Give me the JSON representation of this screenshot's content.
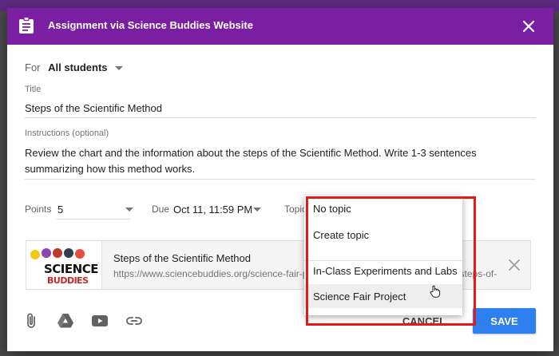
{
  "dialog": {
    "title": "Assignment via Science Buddies Website"
  },
  "assign": {
    "for_label": "For",
    "for_value": "All students"
  },
  "title_field": {
    "label": "Title",
    "value": "Steps of the Scientific Method"
  },
  "instructions_field": {
    "label": "Instructions (optional)",
    "value": "Review the chart and the information about the steps of the Scientific Method. Write 1-3 sentences summarizing how this method works."
  },
  "points": {
    "label": "Points",
    "value": "5"
  },
  "due": {
    "label": "Due",
    "value": "Oct 11, 11:59 PM"
  },
  "topic": {
    "label": "Topic",
    "menu_items": [
      "No topic",
      "Create topic",
      "In-Class Experiments and Labs",
      "Science Fair Project"
    ],
    "hovered_item": "Science Fair Project"
  },
  "attachment": {
    "title": "Steps of the Scientific Method",
    "url": "https://www.sciencebuddies.org/science-fair-projects/engineering-design-process/steps-of-the-scientific-method",
    "thumb_text": [
      "SCIENCE",
      "BUDDIES"
    ]
  },
  "toolbar": {
    "icons": [
      "attach-file-icon",
      "google-drive-icon",
      "youtube-icon",
      "link-icon"
    ]
  },
  "actions": {
    "cancel_label": "CANCEL",
    "save_label": "SAVE"
  },
  "colors": {
    "header": "#7b1fa2",
    "save": "#2e7ff0",
    "highlight": "#e21a1a"
  }
}
